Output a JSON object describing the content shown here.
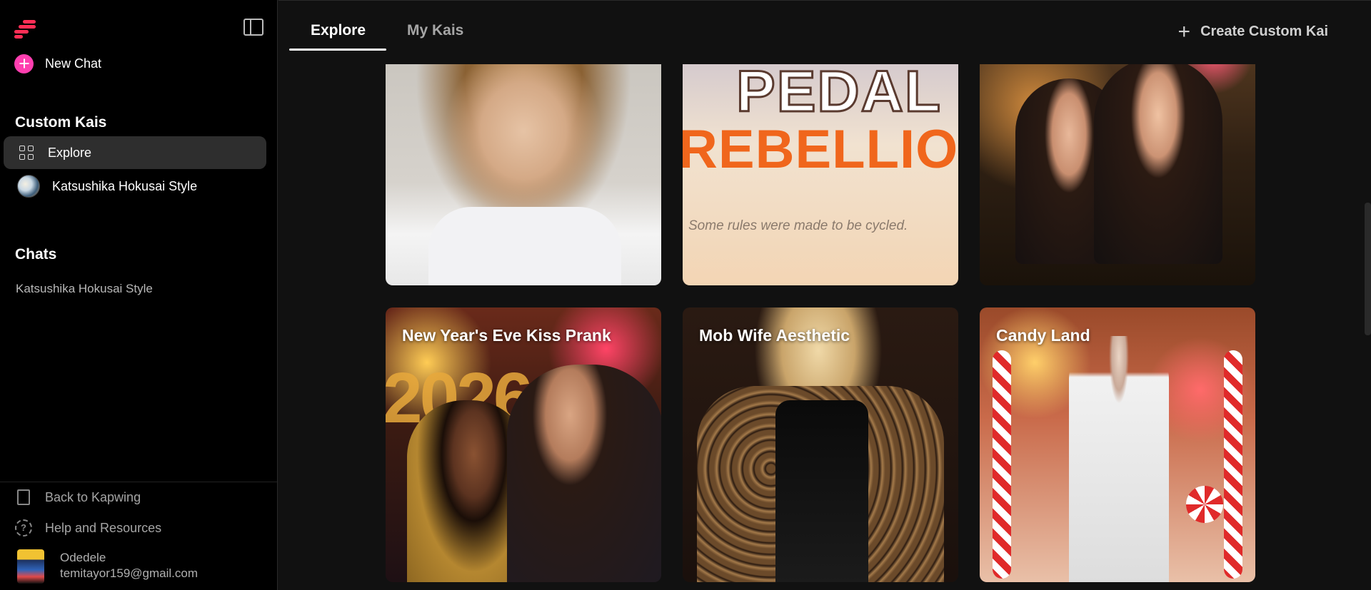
{
  "sidebar": {
    "new_chat": "New Chat",
    "custom_kais_heading": "Custom Kais",
    "custom_kais": [
      {
        "label": "Explore"
      },
      {
        "label": "Katsushika Hokusai Style"
      }
    ],
    "chats_heading": "Chats",
    "chats": [
      {
        "label": "Katsushika Hokusai Style"
      }
    ],
    "back_link": "Back to Kapwing",
    "help_link": "Help and Resources",
    "user": {
      "name": "Odedele",
      "email": "temitayor159@gmail.com"
    }
  },
  "topbar": {
    "tabs": [
      {
        "label": "Explore",
        "active": true
      },
      {
        "label": "My Kais",
        "active": false
      }
    ],
    "create_button": "Create Custom Kai"
  },
  "cards": {
    "row1": [
      {
        "title": ""
      },
      {
        "title": "",
        "image_text_1": "PEDAL",
        "image_text_2": "REBELLION",
        "image_text_3": "Some rules were made to be cycled."
      },
      {
        "title": ""
      }
    ],
    "row2": [
      {
        "title": "New Year's Eve Kiss Prank",
        "image_text": "2026"
      },
      {
        "title": "Mob Wife Aesthetic"
      },
      {
        "title": "Candy Land"
      }
    ]
  },
  "colors": {
    "accent_pink": "#ff3fb0",
    "logo_red": "#ff2e55",
    "sidebar_bg": "#000000",
    "main_bg": "#111111",
    "active_item_bg": "#2e2e2e"
  },
  "icons": {
    "logo": "kapwing-logo-icon",
    "collapse": "sidebar-collapse-icon",
    "new_chat": "plus-circle-icon",
    "explore": "grid-icon",
    "back": "door-exit-icon",
    "help": "help-circle-icon",
    "create": "plus-icon"
  }
}
